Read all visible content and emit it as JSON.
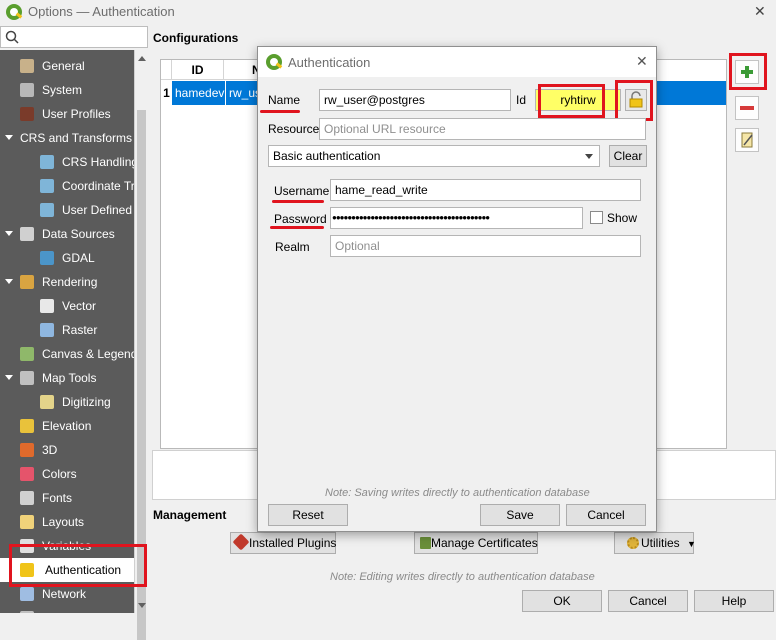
{
  "window": {
    "title": "Options — Authentication",
    "close_glyph": "✕"
  },
  "search": {
    "placeholder": ""
  },
  "sidebar": {
    "items": [
      {
        "label": "General",
        "icon": "wrench-icon",
        "color": "#c8b18a"
      },
      {
        "label": "System",
        "icon": "gear-icon",
        "color": "#b8b8b8"
      },
      {
        "label": "User Profiles",
        "icon": "user-icon",
        "color": "#7a3b2a"
      },
      {
        "label": "CRS and Transforms",
        "icon": "none"
      },
      {
        "label": "CRS Handling",
        "icon": "globe-icon",
        "color": "#7fb5d8"
      },
      {
        "label": "Coordinate Tra",
        "icon": "globe-icon",
        "color": "#7fb5d8"
      },
      {
        "label": "User Defined C",
        "icon": "globe-icon",
        "color": "#7fb5d8"
      },
      {
        "label": "Data Sources",
        "icon": "table-icon",
        "color": "#d0d0d0"
      },
      {
        "label": "GDAL",
        "icon": "gdal-icon",
        "color": "#4b95c9"
      },
      {
        "label": "Rendering",
        "icon": "brush-icon",
        "color": "#d9a441"
      },
      {
        "label": "Vector",
        "icon": "vector-icon",
        "color": "#e8e8e8"
      },
      {
        "label": "Raster",
        "icon": "raster-icon",
        "color": "#8fb7e0"
      },
      {
        "label": "Canvas & Legend",
        "icon": "canvas-icon",
        "color": "#8fb86a"
      },
      {
        "label": "Map Tools",
        "icon": "map-tools-icon",
        "color": "#c0c0c0"
      },
      {
        "label": "Digitizing",
        "icon": "digitize-icon",
        "color": "#e4d48a"
      },
      {
        "label": "Elevation",
        "icon": "elevation-icon",
        "color": "#e9c23b"
      },
      {
        "label": "3D",
        "icon": "cube-icon",
        "color": "#e06a2c"
      },
      {
        "label": "Colors",
        "icon": "palette-icon",
        "color": "#e5546b"
      },
      {
        "label": "Fonts",
        "icon": "font-icon",
        "color": "#d0d0d0"
      },
      {
        "label": "Layouts",
        "icon": "layout-icon",
        "color": "#f0d27a"
      },
      {
        "label": "Variables",
        "icon": "variables-icon",
        "color": "#e0e0e0"
      },
      {
        "label": "Authentication",
        "icon": "lock-icon",
        "color": "#f0c419"
      },
      {
        "label": "Network",
        "icon": "network-icon",
        "color": "#9fbde2"
      },
      {
        "label": "GPS",
        "icon": "gps-icon",
        "color": "#c0c0c0"
      }
    ]
  },
  "main": {
    "configurations_label": "Configurations",
    "table": {
      "headers": [
        "ID",
        "N"
      ],
      "row": {
        "num": "1",
        "id": "hamedev",
        "name": "rw_us"
      }
    },
    "management_label": "Management",
    "installed_plugins_label": "Installed Plugins",
    "manage_certificates_label": "Manage Certificates",
    "utilities_label": "Utilities",
    "note": "Note: Editing writes directly to authentication database",
    "ok_label": "OK",
    "cancel_label": "Cancel",
    "help_label": "Help"
  },
  "dialog": {
    "title": "Authentication",
    "name_label": "Name",
    "name_value": "rw_user@postgres",
    "id_label": "Id",
    "id_value": "ryhtirw",
    "resource_label": "Resource",
    "resource_placeholder": "Optional URL resource",
    "method_value": "Basic authentication",
    "clear_label": "Clear",
    "username_label": "Username",
    "username_value": "hame_read_write",
    "password_label": "Password",
    "password_value": "●●●●●●●●●●●●●●●●●●●●●●●●●●●●●●●●●●●●●●●●●",
    "show_label": "Show",
    "realm_label": "Realm",
    "realm_placeholder": "Optional",
    "note": "Note: Saving writes directly to authentication database",
    "reset_label": "Reset",
    "save_label": "Save",
    "cancel_label": "Cancel"
  },
  "colors": {
    "highlight": "#e0141e",
    "selection": "#0078d7",
    "id_field": "#ffff66"
  }
}
